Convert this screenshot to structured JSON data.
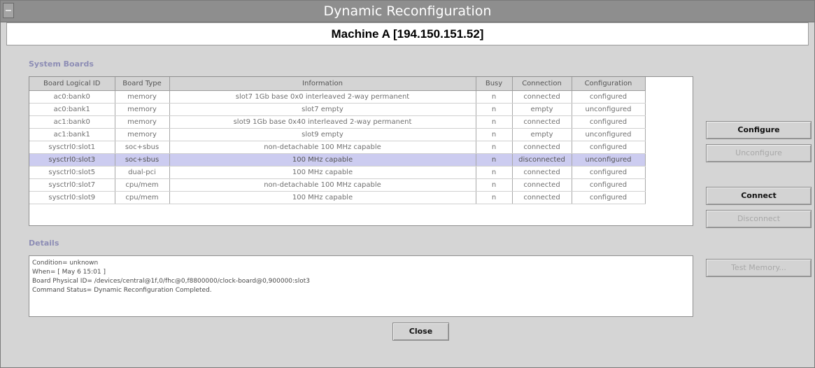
{
  "window": {
    "title": "Dynamic Reconfiguration",
    "machine": "Machine A [194.150.151.52]"
  },
  "system_boards": {
    "label": "System Boards",
    "columns": [
      "Board Logical ID",
      "Board Type",
      "Information",
      "Busy",
      "Connection",
      "Configuration"
    ],
    "rows": [
      {
        "id": "ac0:bank0",
        "type": "memory",
        "info": "slot7 1Gb base 0x0 interleaved 2-way permanent",
        "busy": "n",
        "connection": "connected",
        "configuration": "configured"
      },
      {
        "id": "ac0:bank1",
        "type": "memory",
        "info": "slot7 empty",
        "busy": "n",
        "connection": "empty",
        "configuration": "unconfigured"
      },
      {
        "id": "ac1:bank0",
        "type": "memory",
        "info": "slot9 1Gb base 0x40 interleaved 2-way permanent",
        "busy": "n",
        "connection": "connected",
        "configuration": "configured"
      },
      {
        "id": "ac1:bank1",
        "type": "memory",
        "info": "slot9 empty",
        "busy": "n",
        "connection": "empty",
        "configuration": "unconfigured"
      },
      {
        "id": "sysctrl0:slot1",
        "type": "soc+sbus",
        "info": "non-detachable 100 MHz capable",
        "busy": "n",
        "connection": "connected",
        "configuration": "configured"
      },
      {
        "id": "sysctrl0:slot3",
        "type": "soc+sbus",
        "info": "100 MHz capable",
        "busy": "n",
        "connection": "disconnected",
        "configuration": "unconfigured"
      },
      {
        "id": "sysctrl0:slot5",
        "type": "dual-pci",
        "info": "100 MHz capable",
        "busy": "n",
        "connection": "connected",
        "configuration": "configured"
      },
      {
        "id": "sysctrl0:slot7",
        "type": "cpu/mem",
        "info": "non-detachable 100 MHz capable",
        "busy": "n",
        "connection": "connected",
        "configuration": "configured"
      },
      {
        "id": "sysctrl0:slot9",
        "type": "cpu/mem",
        "info": "100 MHz capable",
        "busy": "n",
        "connection": "connected",
        "configuration": "configured"
      }
    ]
  },
  "details": {
    "label": "Details",
    "lines": [
      "Condition= unknown",
      "When= [ May 6 15:01 ]",
      "Board Physical ID= /devices/central@1f,0/fhc@0,f8800000/clock-board@0,900000:slot3",
      "Command Status= Dynamic Reconfiguration Completed."
    ]
  },
  "buttons": {
    "configure": "Configure",
    "unconfigure": "Unconfigure",
    "connect": "Connect",
    "disconnect": "Disconnect",
    "test_memory": "Test Memory...",
    "close": "Close"
  }
}
